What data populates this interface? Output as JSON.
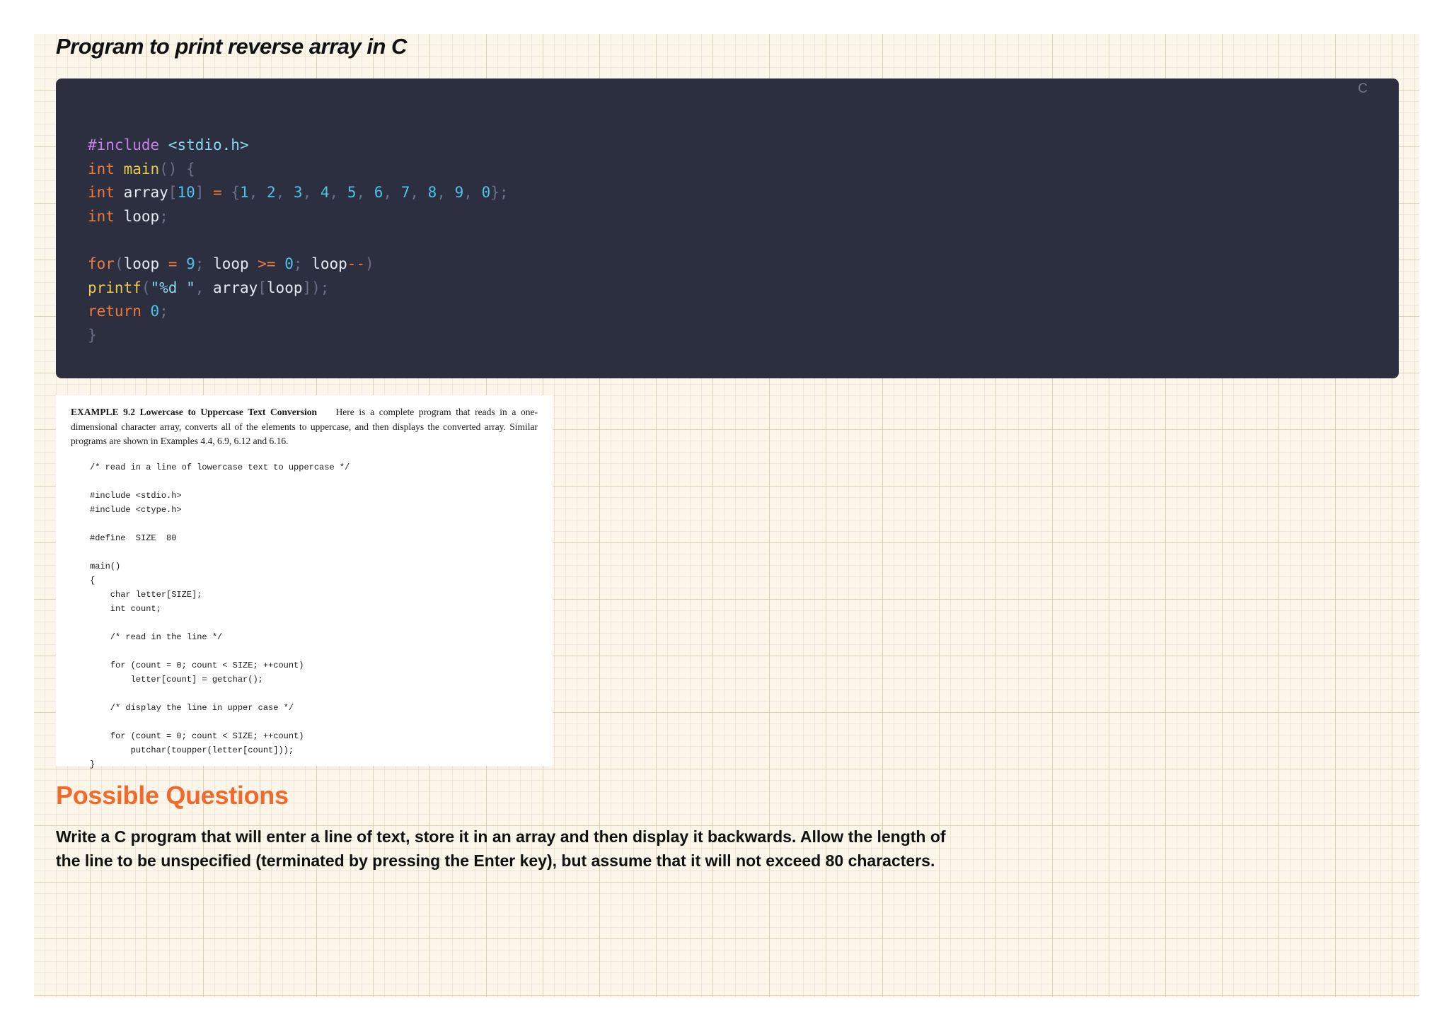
{
  "title": "Program to print reverse array in C",
  "code_block": {
    "language_label": "C",
    "lines": [
      [
        {
          "t": "#include ",
          "c": "pp"
        },
        {
          "t": "<stdio.h>",
          "c": "s"
        }
      ],
      [
        {
          "t": "int ",
          "c": "k"
        },
        {
          "t": "main",
          "c": "f"
        },
        {
          "t": "() {",
          "c": "p"
        }
      ],
      [
        {
          "t": "int ",
          "c": "k"
        },
        {
          "t": "array",
          "c": "v"
        },
        {
          "t": "[",
          "c": "p"
        },
        {
          "t": "10",
          "c": "n"
        },
        {
          "t": "] ",
          "c": "p"
        },
        {
          "t": "= ",
          "c": "k"
        },
        {
          "t": "{",
          "c": "p"
        },
        {
          "t": "1",
          "c": "n"
        },
        {
          "t": ", ",
          "c": "p"
        },
        {
          "t": "2",
          "c": "n"
        },
        {
          "t": ", ",
          "c": "p"
        },
        {
          "t": "3",
          "c": "n"
        },
        {
          "t": ", ",
          "c": "p"
        },
        {
          "t": "4",
          "c": "n"
        },
        {
          "t": ", ",
          "c": "p"
        },
        {
          "t": "5",
          "c": "n"
        },
        {
          "t": ", ",
          "c": "p"
        },
        {
          "t": "6",
          "c": "n"
        },
        {
          "t": ", ",
          "c": "p"
        },
        {
          "t": "7",
          "c": "n"
        },
        {
          "t": ", ",
          "c": "p"
        },
        {
          "t": "8",
          "c": "n"
        },
        {
          "t": ", ",
          "c": "p"
        },
        {
          "t": "9",
          "c": "n"
        },
        {
          "t": ", ",
          "c": "p"
        },
        {
          "t": "0",
          "c": "n"
        },
        {
          "t": "};",
          "c": "p"
        }
      ],
      [
        {
          "t": "int ",
          "c": "k"
        },
        {
          "t": "loop",
          "c": "v"
        },
        {
          "t": ";",
          "c": "p"
        }
      ],
      [],
      [
        {
          "t": "for",
          "c": "k"
        },
        {
          "t": "(",
          "c": "p"
        },
        {
          "t": "loop ",
          "c": "v"
        },
        {
          "t": "= ",
          "c": "k"
        },
        {
          "t": "9",
          "c": "n"
        },
        {
          "t": "; ",
          "c": "p"
        },
        {
          "t": "loop ",
          "c": "v"
        },
        {
          "t": ">= ",
          "c": "k"
        },
        {
          "t": "0",
          "c": "n"
        },
        {
          "t": "; ",
          "c": "p"
        },
        {
          "t": "loop",
          "c": "v"
        },
        {
          "t": "--",
          "c": "k"
        },
        {
          "t": ")",
          "c": "p"
        }
      ],
      [
        {
          "t": "printf",
          "c": "f"
        },
        {
          "t": "(",
          "c": "p"
        },
        {
          "t": "\"%d \"",
          "c": "s"
        },
        {
          "t": ", ",
          "c": "p"
        },
        {
          "t": "array",
          "c": "v"
        },
        {
          "t": "[",
          "c": "p"
        },
        {
          "t": "loop",
          "c": "v"
        },
        {
          "t": "]);",
          "c": "p"
        }
      ],
      [
        {
          "t": "return ",
          "c": "k"
        },
        {
          "t": "0",
          "c": "n"
        },
        {
          "t": ";",
          "c": "p"
        }
      ],
      [
        {
          "t": "}",
          "c": "p"
        }
      ]
    ]
  },
  "scanned_example": {
    "heading": "EXAMPLE 9.2  Lowercase to Uppercase Text Conversion",
    "intro": "Here is a complete program that reads in a one-dimensional character array, converts all of the elements to uppercase, and then displays the converted array.  Similar programs are shown in Examples 4.4, 6.9, 6.12 and 6.16.",
    "code_lines": [
      "/* read in a line of lowercase text to uppercase */",
      "",
      "#include <stdio.h>",
      "#include <ctype.h>",
      "",
      "#define  SIZE  80",
      "",
      "main()",
      "{",
      "    char letter[SIZE];",
      "    int count;",
      "",
      "    /* read in the line */",
      "",
      "    for (count = 0; count < SIZE; ++count)",
      "        letter[count] = getchar();",
      "",
      "    /* display the line in upper case */",
      "",
      "    for (count = 0; count < SIZE; ++count)",
      "        putchar(toupper(letter[count]));",
      "}"
    ]
  },
  "section_heading": "Possible Questions",
  "question": "Write a C program that will enter a line of text, store it in an array and then display it backwards. Allow the length of the line to be unspecified (terminated by pressing the Enter key), but assume that it will not exceed 80 characters."
}
